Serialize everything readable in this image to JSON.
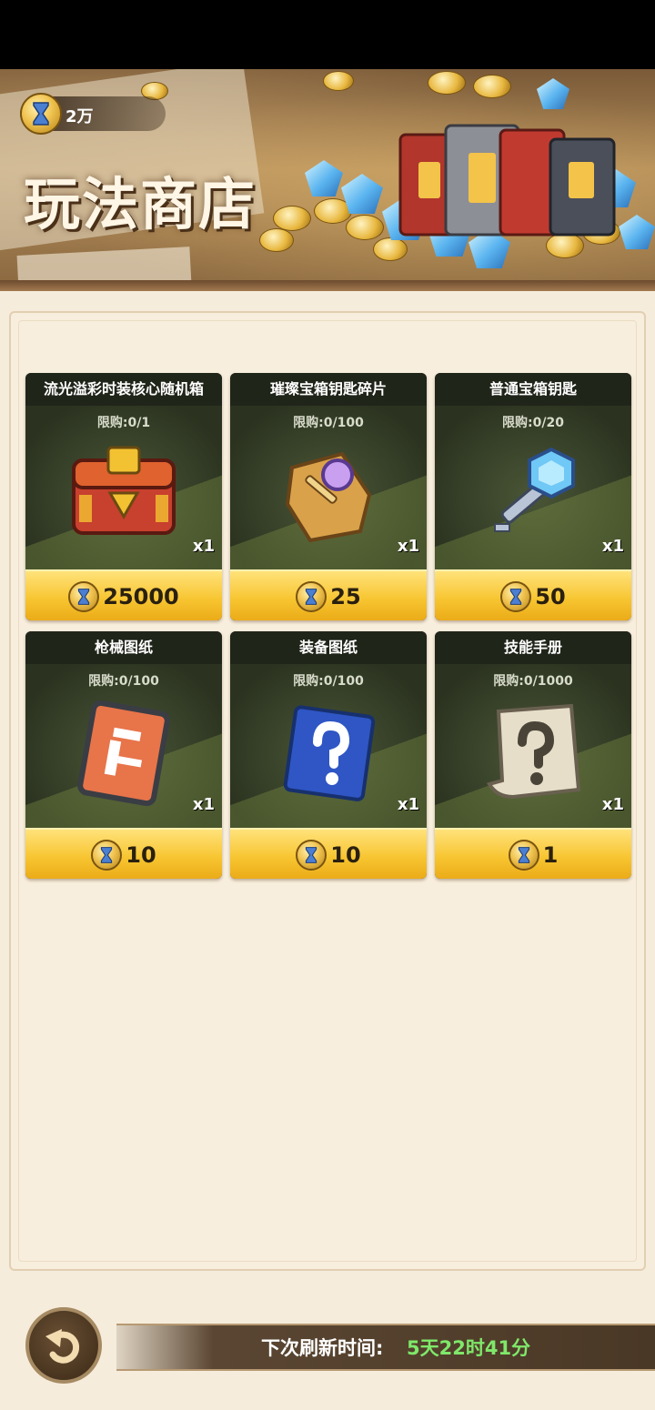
{
  "header": {
    "currency_amount": "2万",
    "shop_title": "玩法商店"
  },
  "items": [
    {
      "name": "流光溢彩时装核心随机箱",
      "limit": "限购:0/1",
      "qty": "x1",
      "price": "25000",
      "icon": "treasure-chest-icon"
    },
    {
      "name": "璀璨宝箱钥匙碎片",
      "limit": "限购:0/100",
      "qty": "x1",
      "price": "25",
      "icon": "key-fragment-icon"
    },
    {
      "name": "普通宝箱钥匙",
      "limit": "限购:0/20",
      "qty": "x1",
      "price": "50",
      "icon": "blue-key-icon"
    },
    {
      "name": "枪械图纸",
      "limit": "限购:0/100",
      "qty": "x1",
      "price": "10",
      "icon": "gun-blueprint-icon"
    },
    {
      "name": "装备图纸",
      "limit": "限购:0/100",
      "qty": "x1",
      "price": "10",
      "icon": "equipment-blueprint-icon"
    },
    {
      "name": "技能手册",
      "limit": "限购:0/1000",
      "qty": "x1",
      "price": "1",
      "icon": "skill-manual-icon"
    }
  ],
  "footer": {
    "refresh_label": "下次刷新时间:",
    "refresh_value": "5天22时41分"
  },
  "colors": {
    "price_bar": "#f7c531",
    "refresh_value": "#7fe86a",
    "card_bg": "#2e3424",
    "panel_bg": "#f8eedd"
  }
}
